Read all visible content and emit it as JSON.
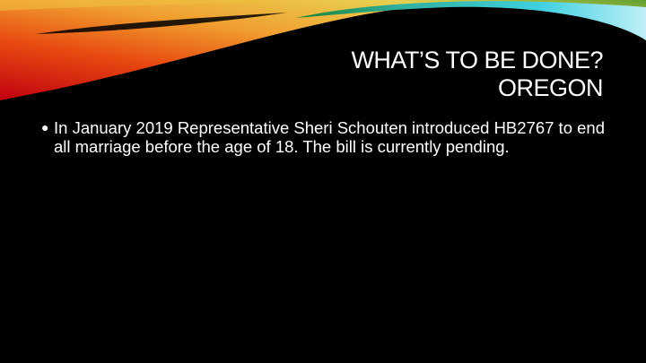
{
  "title": {
    "line1": "WHAT’S TO BE DONE?",
    "line2": "OREGON"
  },
  "bullets": [
    "In January 2019 Representative Sheri Schouten introduced HB2767 to end all marriage before the age of 18.  The bill is currently pending."
  ],
  "colors": {
    "background": "#000000",
    "text": "#ffffff"
  }
}
